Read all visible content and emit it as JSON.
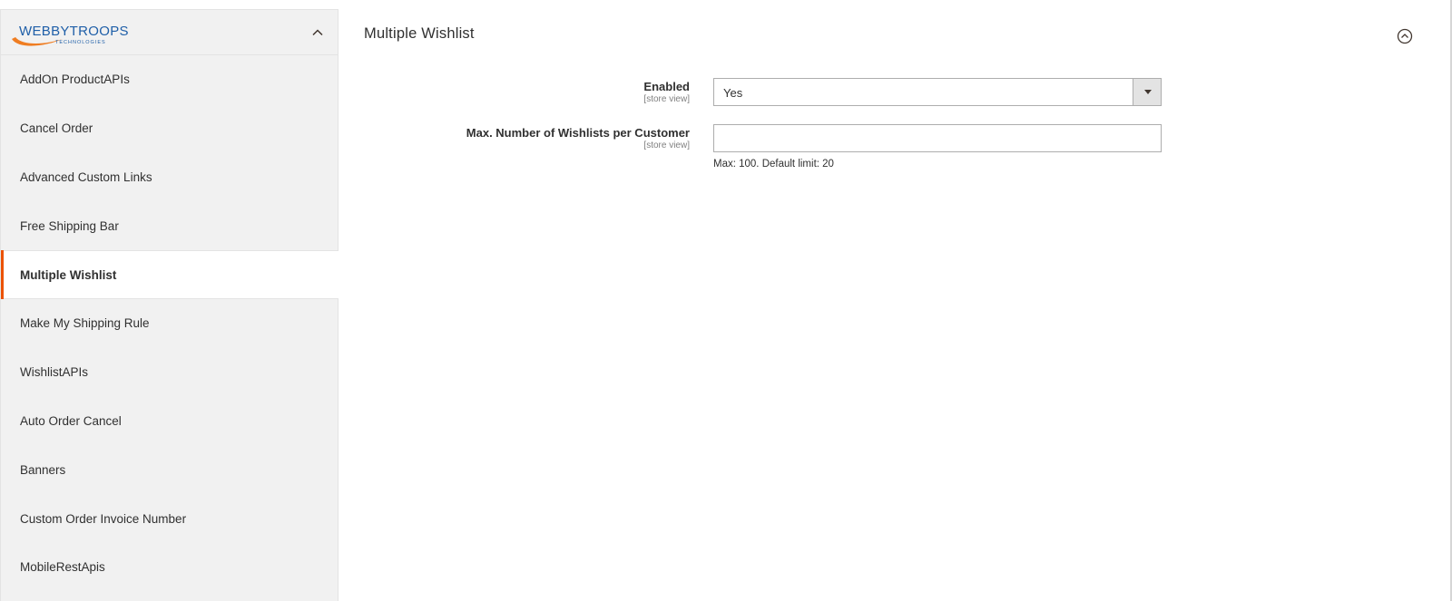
{
  "sidebar": {
    "logo": {
      "text_main": "WEBBYTROOPS",
      "text_sub": "TECHNOLOGIES",
      "colors": {
        "main": "#1f5fa8",
        "swoosh": "#ef7d22"
      }
    },
    "collapse_icon": "chevron-up-icon",
    "items": [
      {
        "label": "AddOn ProductAPIs",
        "active": false
      },
      {
        "label": "Cancel Order",
        "active": false
      },
      {
        "label": "Advanced Custom Links",
        "active": false
      },
      {
        "label": "Free Shipping Bar",
        "active": false
      },
      {
        "label": "Multiple Wishlist",
        "active": true
      },
      {
        "label": "Make My Shipping Rule",
        "active": false
      },
      {
        "label": "WishlistAPIs",
        "active": false
      },
      {
        "label": "Auto Order Cancel",
        "active": false
      },
      {
        "label": "Banners",
        "active": false
      },
      {
        "label": "Custom Order Invoice Number",
        "active": false
      },
      {
        "label": "MobileRestApis",
        "active": false
      }
    ]
  },
  "main": {
    "section_title": "Multiple Wishlist",
    "section_toggle_icon": "collapse-circle-icon",
    "fields": {
      "enabled": {
        "label": "Enabled",
        "scope": "[store view]",
        "value": "Yes"
      },
      "max_wishlists": {
        "label": "Max. Number of Wishlists per Customer",
        "scope": "[store view]",
        "value": "",
        "note": "Max: 100. Default limit: 20"
      }
    }
  },
  "colors": {
    "accent": "#eb5202",
    "sidebar_bg": "#f1f1f1",
    "input_border": "#adadad"
  }
}
